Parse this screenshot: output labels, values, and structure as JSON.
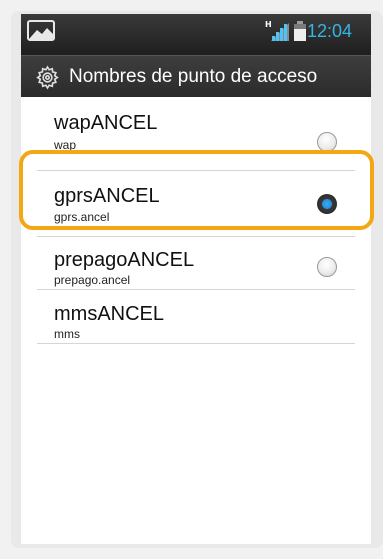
{
  "status_bar": {
    "time": "12:04",
    "network_type": "H",
    "icons": [
      "image-notification-icon",
      "signal-strength-icon",
      "battery-icon"
    ]
  },
  "title_bar": {
    "icon": "settings-gear-icon",
    "title": "Nombres de punto de acceso"
  },
  "apn_list": {
    "items": [
      {
        "name": "wapANCEL",
        "apn": "wap",
        "selected": false
      },
      {
        "name": "gprsANCEL",
        "apn": "gprs.ancel",
        "selected": true
      },
      {
        "name": "prepagoANCEL",
        "apn": "prepago.ancel",
        "selected": false
      },
      {
        "name": "mmsANCEL",
        "apn": "mms",
        "selected": false
      }
    ]
  },
  "colors": {
    "accent_blue": "#33b5e5",
    "highlight_orange": "#f3a714",
    "status_bar_bg": "#2b2b2b",
    "list_bg": "#ffffff"
  }
}
